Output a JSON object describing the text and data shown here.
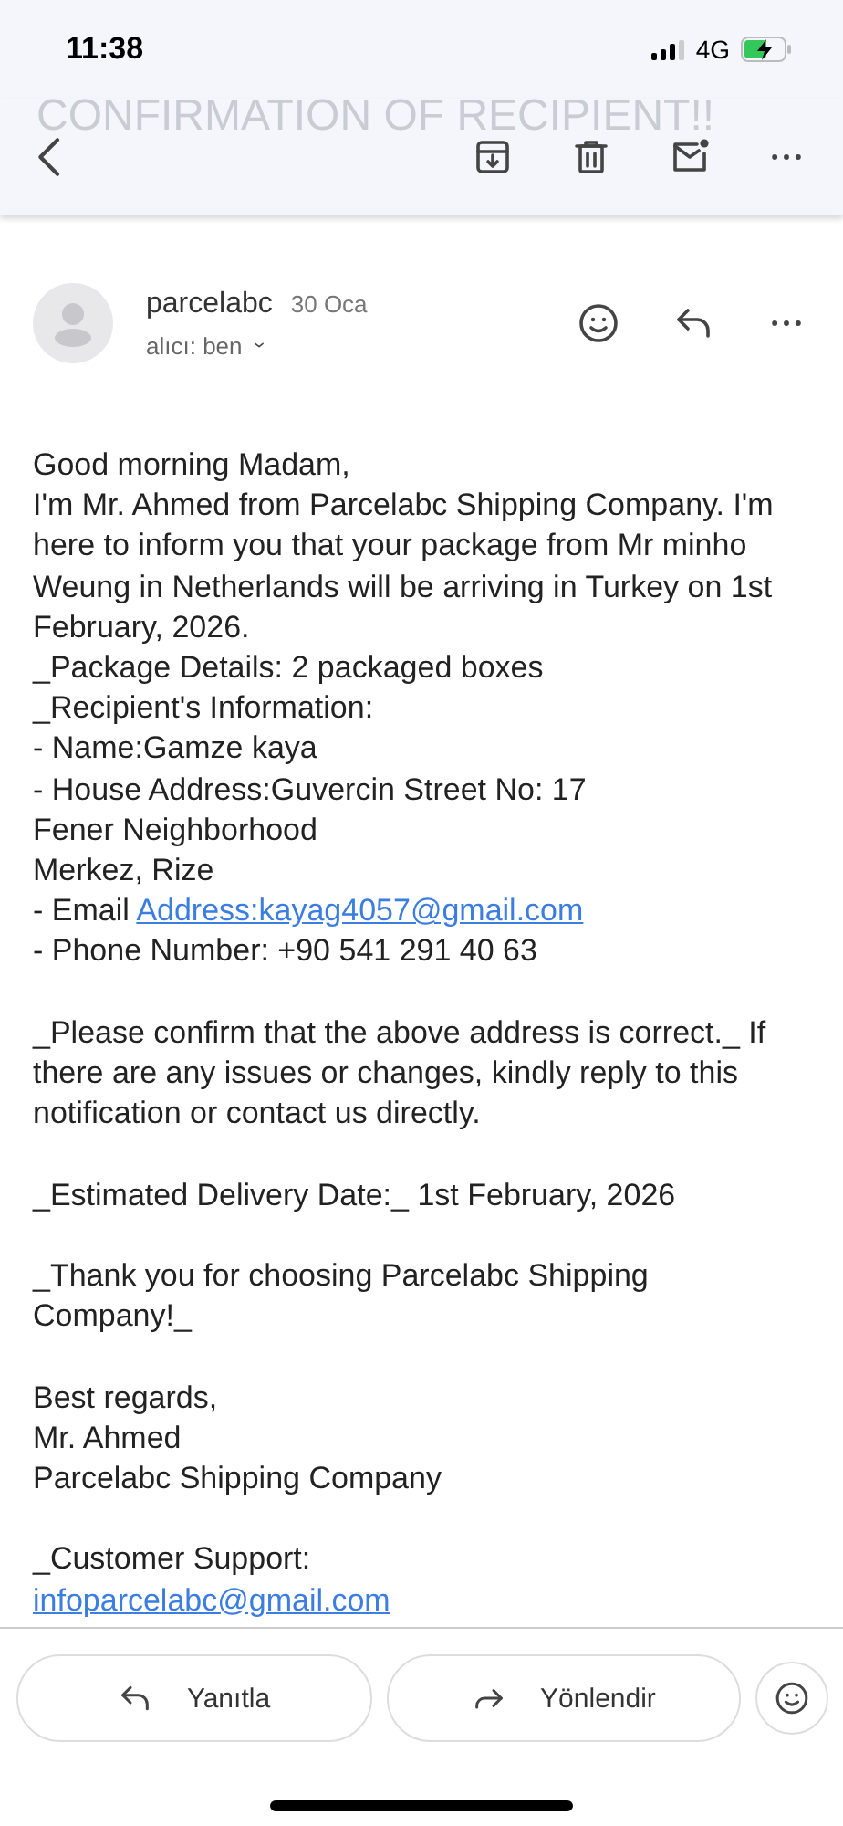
{
  "status_bar": {
    "time": "11:38",
    "network": "4G"
  },
  "toolbar": {
    "faded_title": "CONFIRMATION OF RECIPIENT!!"
  },
  "message": {
    "sender": "parcelabc",
    "date": "30 Oca",
    "recipient": "alıcı: ben"
  },
  "body": [
    {
      "lines": [
        {
          "text": "Good morning Madam,"
        },
        {
          "text": "I'm Mr. Ahmed from Parcelabc Shipping Company. I'm here to inform you that your package from Mr minho Weung in Netherlands will be arriving in Turkey on 1st February, 2026."
        },
        {
          "text": "_Package Details: 2 packaged boxes"
        },
        {
          "text": "_Recipient's Information:"
        },
        {
          "text": "- Name:Gamze kaya"
        },
        {
          "text": "- House Address:Guvercin Street No: 17"
        },
        {
          "text": "Fener Neighborhood"
        },
        {
          "text": "Merkez, Rize"
        },
        {
          "text": "- Email ",
          "link": "Address:kayag4057@gmail.com"
        },
        {
          "text": "- Phone Number: +90 541 291 40 63"
        }
      ]
    },
    {
      "lines": [
        {
          "text": "_Please confirm that the above address is correct._ If there are any issues or changes, kindly reply to this notification or contact us directly."
        }
      ]
    },
    {
      "lines": [
        {
          "text": "_Estimated Delivery Date:_ 1st February, 2026"
        }
      ]
    },
    {
      "lines": [
        {
          "text": "_Thank you for choosing Parcelabc Shipping Company!_"
        }
      ]
    },
    {
      "lines": [
        {
          "text": "Best regards,"
        },
        {
          "text": "Mr. Ahmed"
        },
        {
          "text": "Parcelabc Shipping Company"
        }
      ]
    },
    {
      "lines": [
        {
          "text": "_Customer Support:"
        },
        {
          "link": "infoparcelabc@gmail.com"
        }
      ]
    }
  ],
  "actions": [
    {
      "label": "Yanıtla",
      "kind": "reply"
    },
    {
      "label": "Yönlendir",
      "kind": "forward"
    }
  ]
}
